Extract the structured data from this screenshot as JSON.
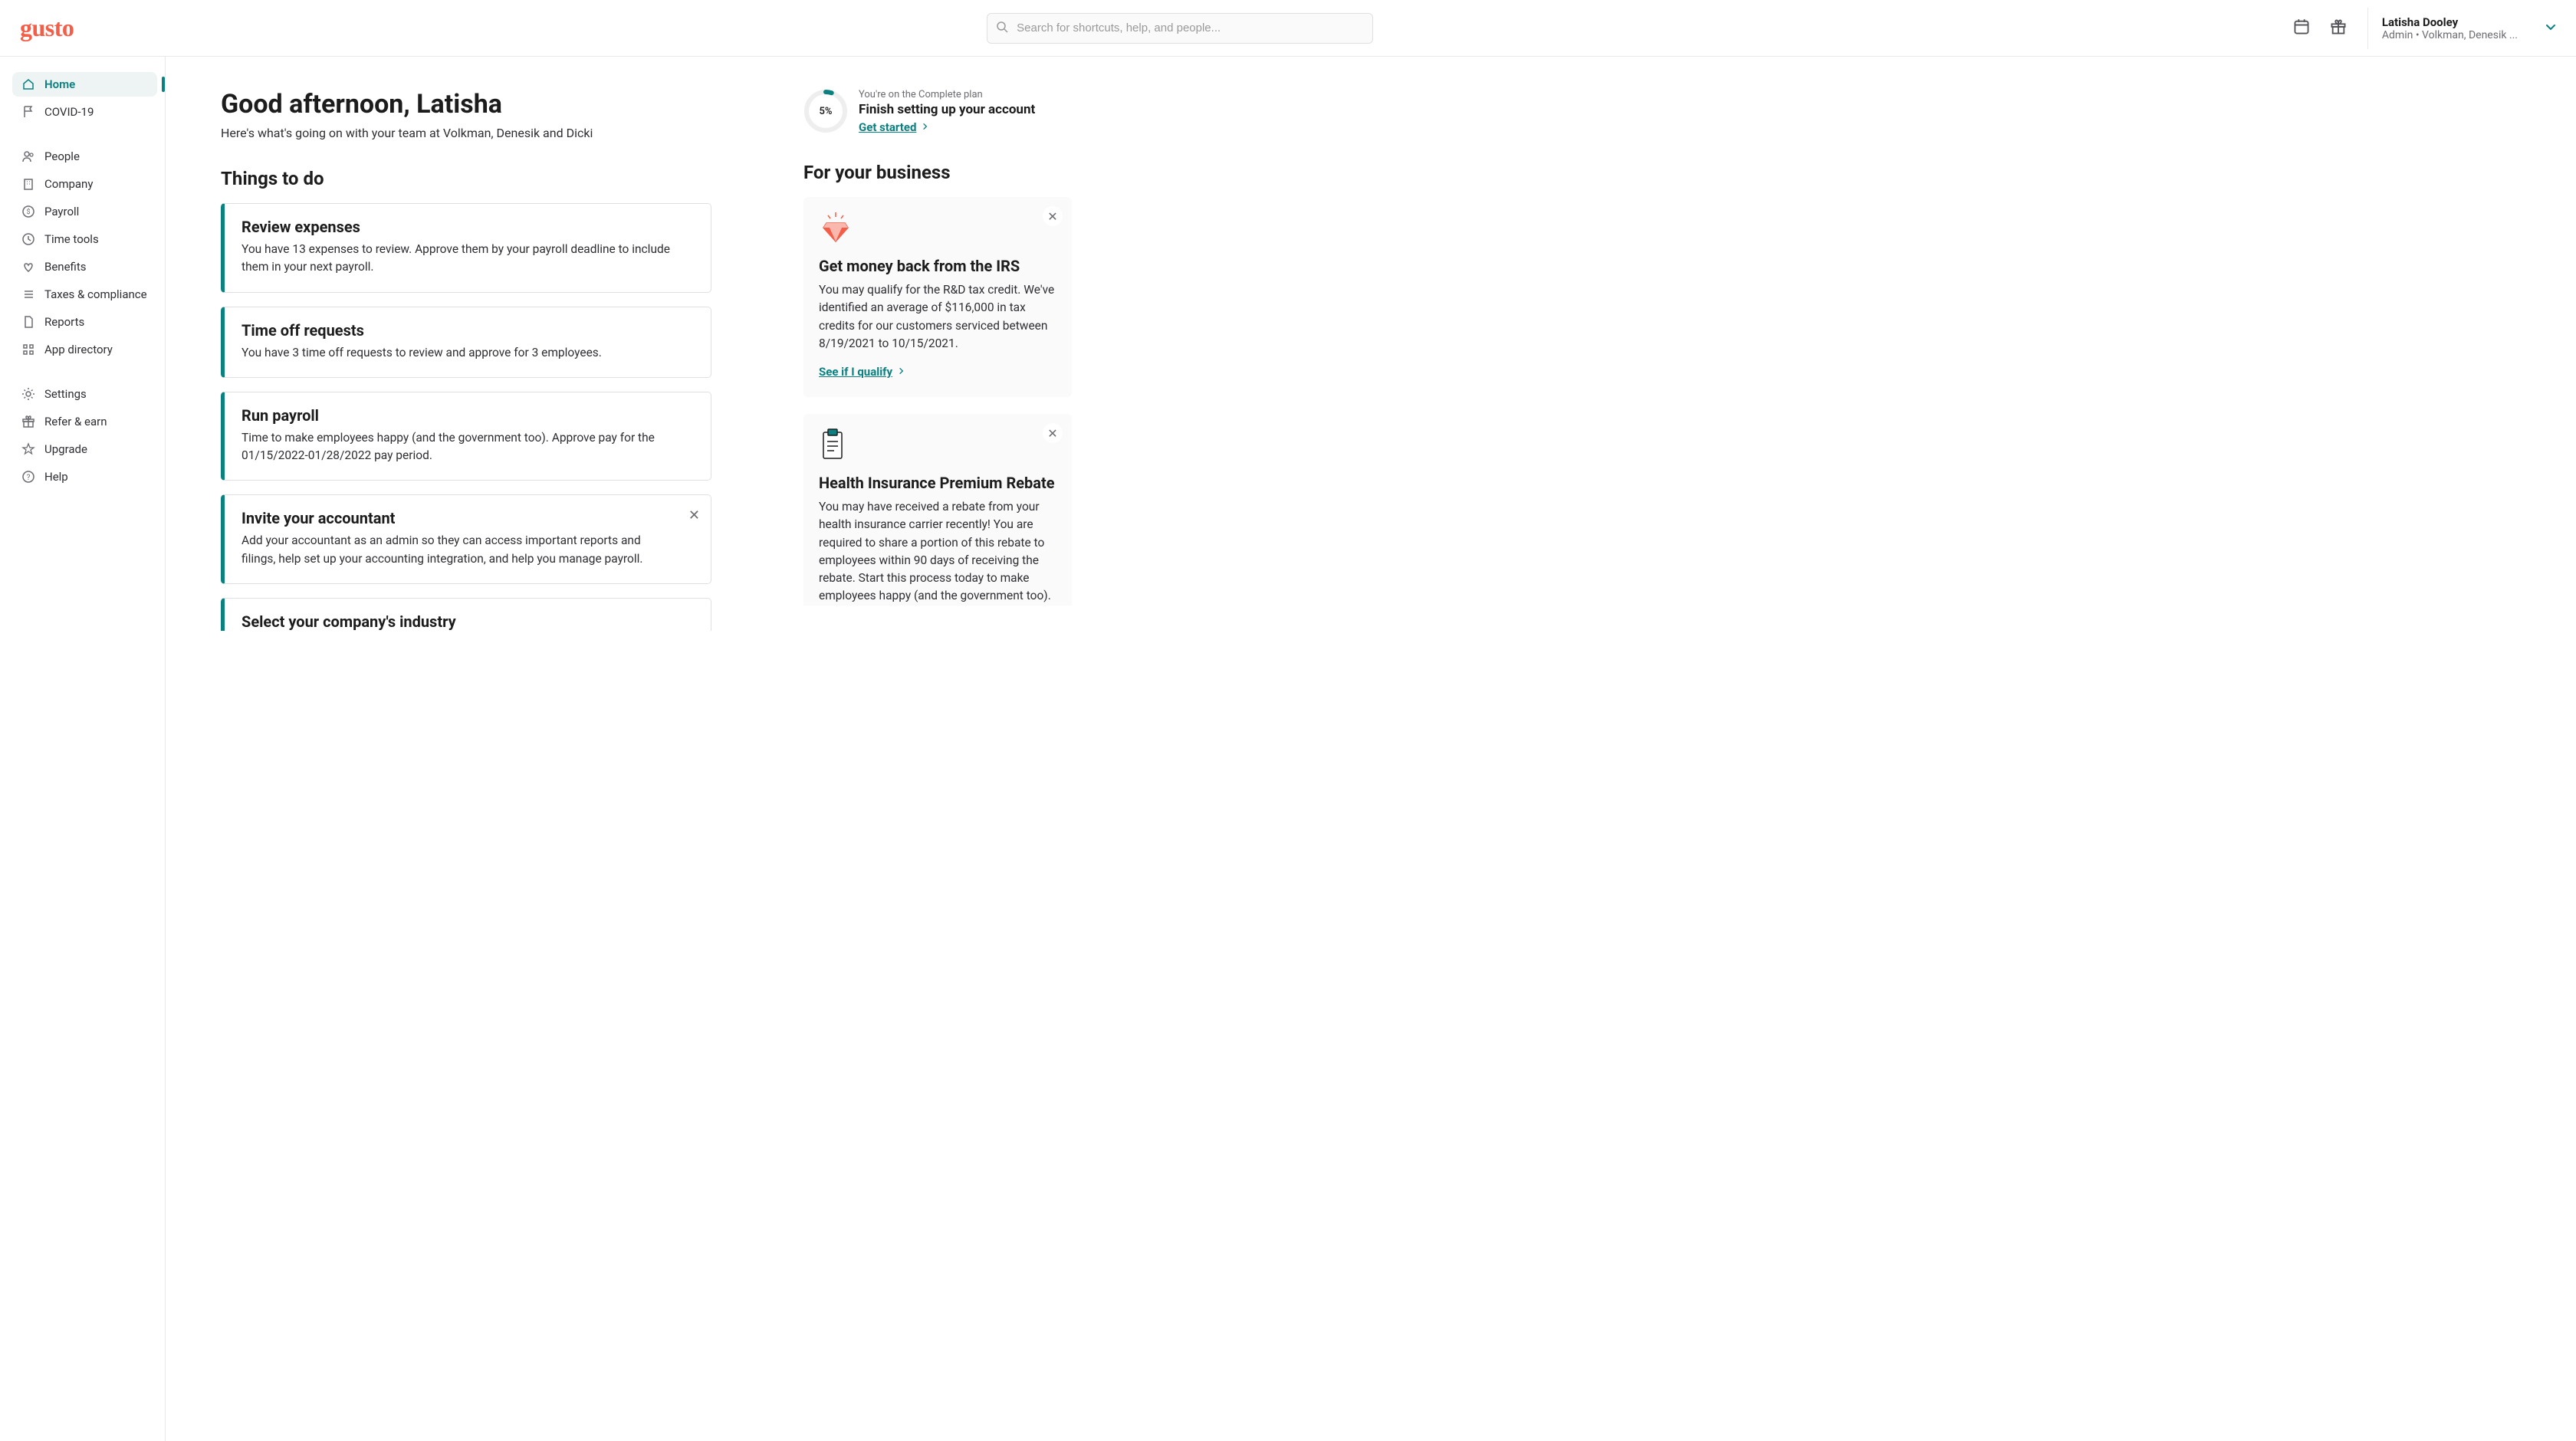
{
  "header": {
    "logo_text": "gusto",
    "search_placeholder": "Search for shortcuts, help, and people...",
    "user_name": "Latisha Dooley",
    "user_subline": "Admin • Volkman, Denesik ..."
  },
  "sidebar": {
    "items": [
      {
        "label": "Home",
        "icon": "home-icon",
        "active": true
      },
      {
        "label": "COVID-19",
        "icon": "flag-icon",
        "active": false
      },
      {
        "gap": true
      },
      {
        "label": "People",
        "icon": "people-icon",
        "active": false
      },
      {
        "label": "Company",
        "icon": "building-icon",
        "active": false
      },
      {
        "label": "Payroll",
        "icon": "dollar-icon",
        "active": false
      },
      {
        "label": "Time tools",
        "icon": "clock-icon",
        "active": false
      },
      {
        "label": "Benefits",
        "icon": "heart-icon",
        "active": false
      },
      {
        "label": "Taxes & compliance",
        "icon": "list-icon",
        "active": false
      },
      {
        "label": "Reports",
        "icon": "document-icon",
        "active": false
      },
      {
        "label": "App directory",
        "icon": "grid-icon",
        "active": false
      },
      {
        "gap": true
      },
      {
        "label": "Settings",
        "icon": "gear-icon",
        "active": false
      },
      {
        "label": "Refer & earn",
        "icon": "gift-small-icon",
        "active": false
      },
      {
        "label": "Upgrade",
        "icon": "star-icon",
        "active": false
      },
      {
        "label": "Help",
        "icon": "help-icon",
        "active": false
      }
    ]
  },
  "greeting": {
    "title": "Good afternoon, Latisha",
    "subtitle": "Here's what's going on with your team at Volkman, Denesik and Dicki"
  },
  "things_to_do": {
    "title": "Things to do",
    "cards": [
      {
        "title": "Review expenses",
        "desc": "You have 13 expenses to review. Approve them by your payroll deadline to include them in your next payroll.",
        "dismissible": false
      },
      {
        "title": "Time off requests",
        "desc": "You have 3 time off requests to review and approve for 3 employees.",
        "dismissible": false
      },
      {
        "title": "Run payroll",
        "desc": "Time to make employees happy (and the government too). Approve pay for the 01/15/2022-01/28/2022 pay period.",
        "dismissible": false
      },
      {
        "title": "Invite your accountant",
        "desc": "Add your accountant as an admin so they can access important reports and filings, help set up your accounting integration, and help you manage payroll.",
        "dismissible": true
      },
      {
        "title": "Select your company's industry",
        "desc": "",
        "dismissible": false,
        "partial": true
      }
    ]
  },
  "setup": {
    "plan_line": "You're on the Complete plan",
    "title": "Finish setting up your account",
    "cta": "Get started",
    "progress_percent": 5,
    "progress_label": "5%"
  },
  "for_your_business": {
    "title": "For your business",
    "cards": [
      {
        "icon": "diamond",
        "title": "Get money back from the IRS",
        "desc": "You may qualify for the R&D tax credit. We've identified an average of $116,000 in tax credits for our customers serviced between 8/19/2021 to 10/15/2021.",
        "cta": "See if I qualify"
      },
      {
        "icon": "clipboard",
        "title": "Health Insurance Premium Rebate",
        "desc": "You may have received a rebate from your health insurance carrier recently! You are required to share a portion of this rebate to employees within 90 days of receiving the rebate. Start this process today to make employees happy (and the government too).",
        "cta": ""
      }
    ]
  }
}
